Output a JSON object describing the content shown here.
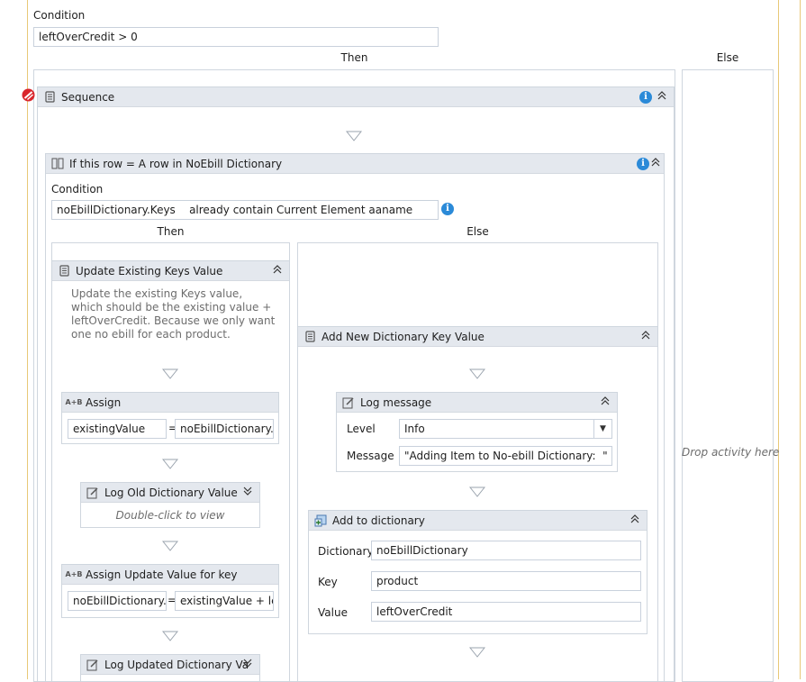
{
  "outer": {
    "condition_label": "Condition",
    "condition_value": "leftOverCredit > 0",
    "then_label": "Then",
    "else_label": "Else",
    "drop_hint": "Drop activity here"
  },
  "sequence": {
    "title": "Sequence"
  },
  "if_row": {
    "title": "If this row = A row in NoEbill Dictionary",
    "condition_label": "Condition",
    "condition_value": "noEbillDictionary.Keys    already contain Current Element aaname",
    "then_label": "Then",
    "else_label": "Else"
  },
  "update_keys": {
    "title": "Update Existing Keys Value",
    "description": "Update the existing Keys value, which should be the existing value + leftOverCredit. Because we only want one no ebill for each product."
  },
  "assign": {
    "title": "Assign",
    "to": "existingValue",
    "eq": "=",
    "value": "noEbillDictionary.It"
  },
  "log_old": {
    "title": "Log Old Dictionary Value",
    "hint": "Double-click to view"
  },
  "assign_update": {
    "title": "Assign Update Value for key",
    "to": "noEbillDictionary.It",
    "eq": "=",
    "value": "existingValue + left"
  },
  "log_updated": {
    "title": "Log Updated Dictionary Va"
  },
  "add_new": {
    "title": "Add New Dictionary Key Value"
  },
  "log_message": {
    "title": "Log message",
    "level_label": "Level",
    "level_value": "Info",
    "message_label": "Message",
    "message_value": "\"Adding Item to No-ebill Dictionary:  \" + le"
  },
  "add_dict": {
    "title": "Add to dictionary",
    "dictionary_label": "Dictionary",
    "dictionary_value": "noEbillDictionary",
    "key_label": "Key",
    "key_value": "product",
    "value_label": "Value",
    "value_value": "leftOverCredit"
  },
  "colors": {
    "header_bg": "#e4e8ee",
    "border": "#cfd6de",
    "info_blue": "#2b8ad8",
    "outline_gold": "#e8c978",
    "error_red": "#d9262c"
  }
}
